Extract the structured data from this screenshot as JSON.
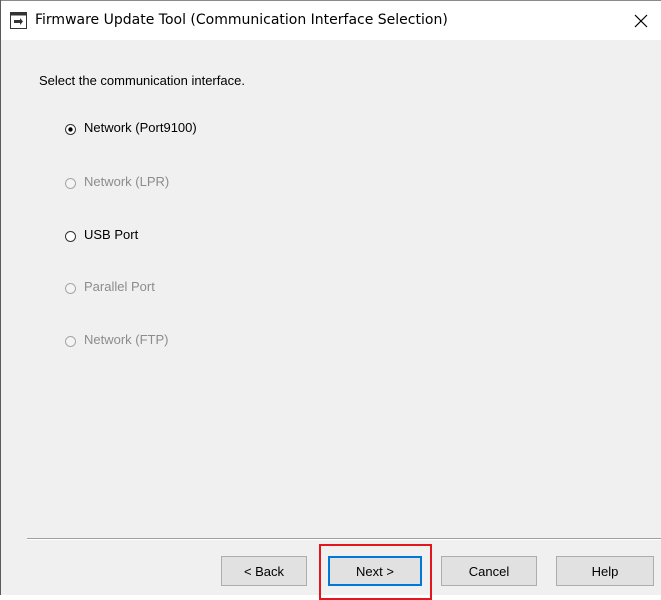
{
  "window": {
    "title": "Firmware Update Tool (Communication Interface Selection)",
    "icon": "app-update-icon",
    "close_icon": "close-icon"
  },
  "instruction": "Select the communication interface.",
  "options": [
    {
      "label": "Network (Port9100)",
      "selected": true,
      "enabled": true
    },
    {
      "label": "Network (LPR)",
      "selected": false,
      "enabled": false
    },
    {
      "label": "USB Port",
      "selected": false,
      "enabled": true
    },
    {
      "label": "Parallel Port",
      "selected": false,
      "enabled": false
    },
    {
      "label": "Network (FTP)",
      "selected": false,
      "enabled": false
    }
  ],
  "buttons": {
    "back": "< Back",
    "next": "Next >",
    "cancel": "Cancel",
    "help": "Help"
  },
  "colors": {
    "highlight": "#e3161d",
    "default_button_accent": "#0078d7",
    "disabled_text": "#8c8c8c"
  }
}
